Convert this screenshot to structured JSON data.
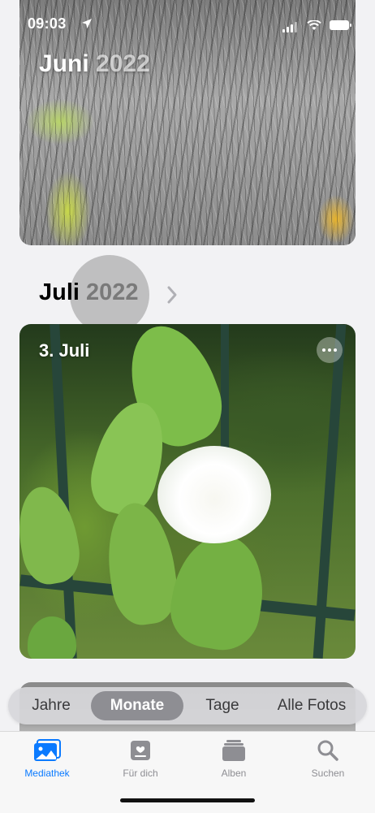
{
  "status_bar": {
    "time": "09:03"
  },
  "top_card": {
    "month": "Juni",
    "year": "2022"
  },
  "section": {
    "month": "Juli",
    "year": "2022"
  },
  "photo_card": {
    "date": "3. Juli"
  },
  "segments": [
    {
      "label": "Jahre",
      "selected": false
    },
    {
      "label": "Monate",
      "selected": true
    },
    {
      "label": "Tage",
      "selected": false
    },
    {
      "label": "Alle Fotos",
      "selected": false
    }
  ],
  "tabs": [
    {
      "label": "Mediathek",
      "icon": "photo-library-icon",
      "active": true
    },
    {
      "label": "Für dich",
      "icon": "for-you-icon",
      "active": false
    },
    {
      "label": "Alben",
      "icon": "albums-icon",
      "active": false
    },
    {
      "label": "Suchen",
      "icon": "search-icon",
      "active": false
    }
  ],
  "colors": {
    "accent": "#0a7aff",
    "segment_selected": "#8e8e93"
  }
}
